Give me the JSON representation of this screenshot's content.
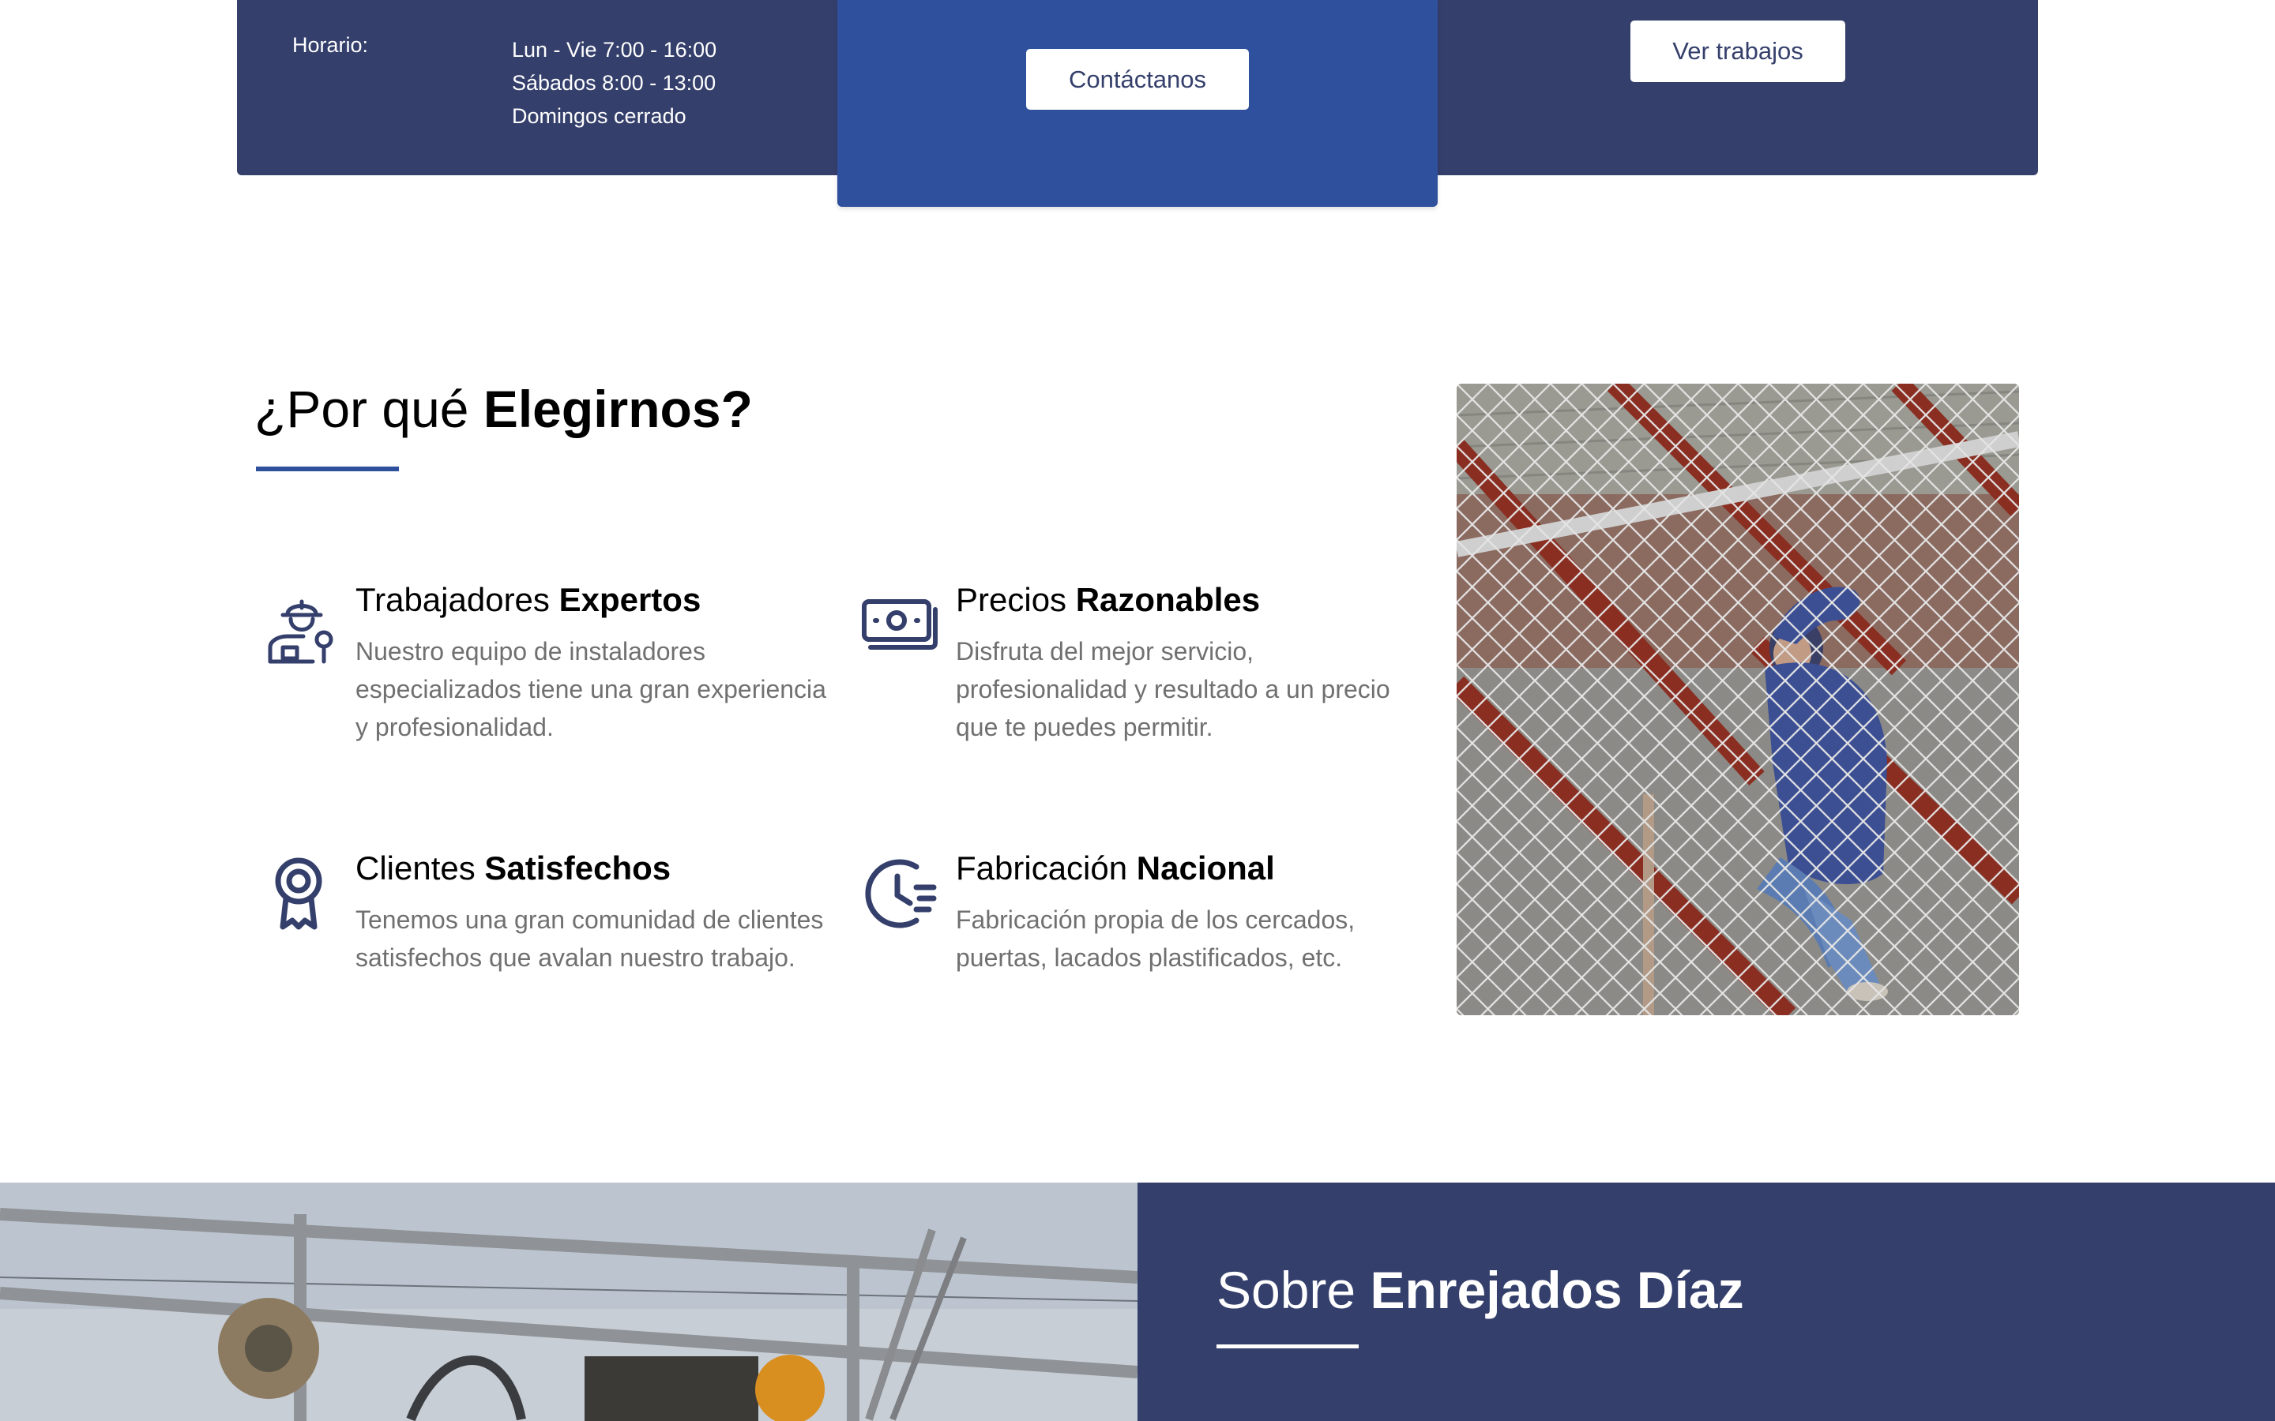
{
  "info": {
    "hours_label": "Horario:",
    "hours": [
      "Lun - Vie 7:00 - 16:00",
      "Sábados 8:00 - 13:00",
      "Domingos cerrado"
    ],
    "contact_button": "Contáctanos",
    "works_button": "Ver trabajos"
  },
  "why": {
    "title_regular": "¿Por qué ",
    "title_bold": "Elegirnos?",
    "features": [
      {
        "icon": "worker-icon",
        "title_regular": "Trabajadores ",
        "title_bold": "Expertos",
        "description": "Nuestro equipo de instaladores especializados tiene una gran experiencia y profesionalidad."
      },
      {
        "icon": "money-icon",
        "title_regular": "Precios ",
        "title_bold": "Razonables",
        "description": "Disfruta del mejor servicio, profesionalidad y resultado a un precio que te puedes permitir."
      },
      {
        "icon": "award-ribbon-icon",
        "title_regular": "Clientes ",
        "title_bold": "Satisfechos",
        "description": "Tenemos una gran comunidad de clientes satisfechos que avalan nuestro trabajo."
      },
      {
        "icon": "clock-icon",
        "title_regular": "Fabricación ",
        "title_bold": "Nacional",
        "description": "Fabricación propia de los cercados, puertas, lacados plastificados, etc."
      }
    ]
  },
  "about": {
    "title_regular": "Sobre ",
    "title_bold": "Enrejados Díaz"
  },
  "colors": {
    "navy": "#343f6b",
    "blue": "#2f509c",
    "text_gray": "#707070"
  }
}
